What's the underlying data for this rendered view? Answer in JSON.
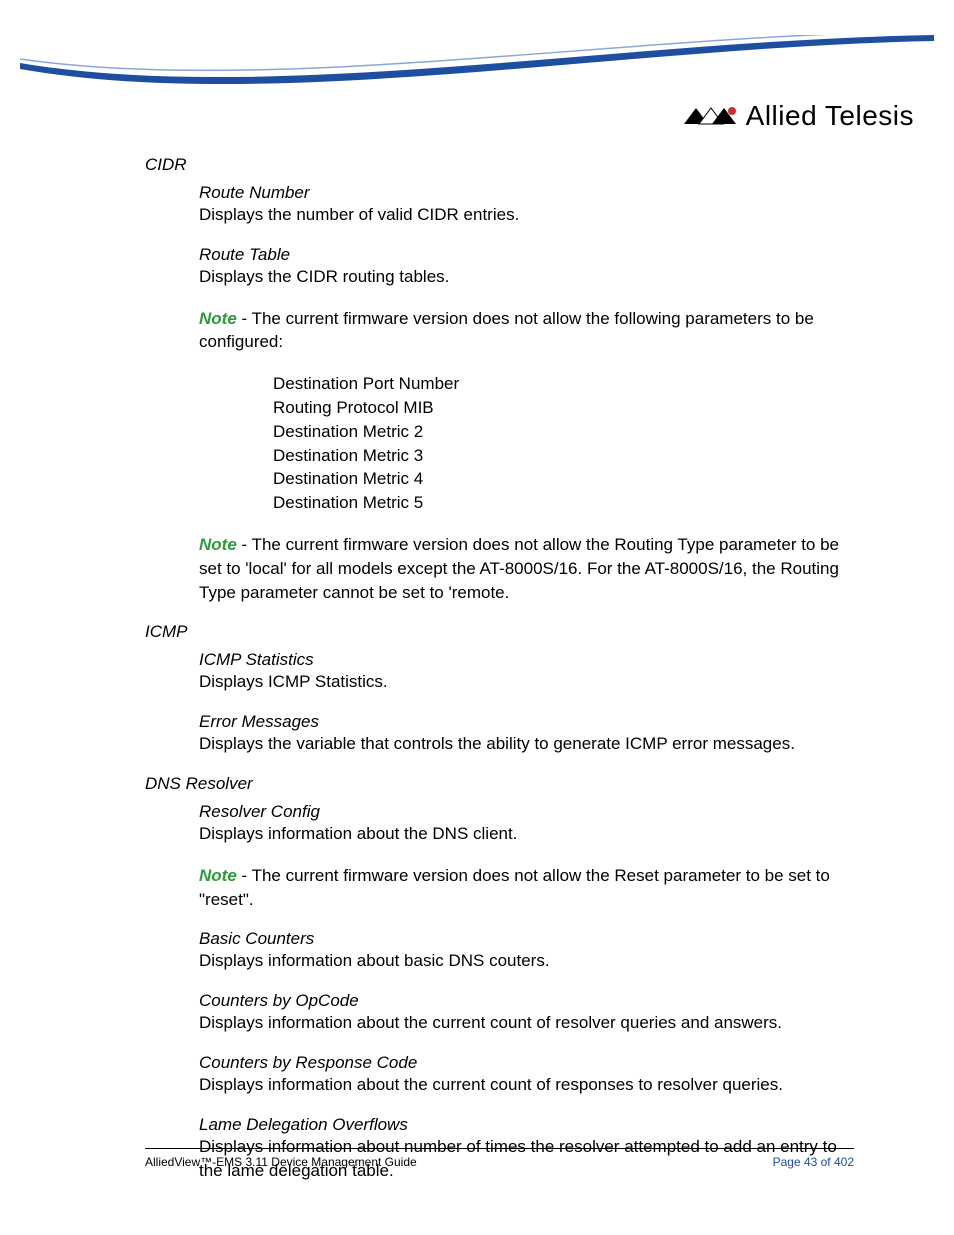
{
  "brand": {
    "name": "Allied Telesis"
  },
  "footer": {
    "left": "AlliedView™-EMS 3.11 Device Management Guide",
    "right": "Page 43 of 402"
  },
  "sections": {
    "cidr": {
      "heading": "CIDR",
      "route_number_title": "Route Number",
      "route_number_desc": "Displays the number of valid CIDR entries.",
      "route_table_title": "Route Table",
      "route_table_desc": "Displays the CIDR routing tables.",
      "note1_label": "Note",
      "note1_text": " - The current firmware version does not allow the following parameters to be configured:",
      "params": [
        "Destination Port Number",
        "Routing Protocol MIB",
        "Destination Metric 2",
        "Destination Metric 3",
        "Destination Metric 4",
        "Destination Metric 5"
      ],
      "note2_label": "Note",
      "note2_text": " - The current firmware version does not allow the Routing Type parameter to be set to 'local' for all models except the AT-8000S/16. For the AT-8000S/16, the Routing Type parameter cannot be set to 'remote."
    },
    "icmp": {
      "heading": "ICMP",
      "stats_title": "ICMP Statistics",
      "stats_desc": "Displays ICMP Statistics.",
      "err_title": "Error Messages",
      "err_desc": "Displays the variable that controls the ability to generate ICMP error messages."
    },
    "dns": {
      "heading": "DNS Resolver",
      "resolver_title": "Resolver Config",
      "resolver_desc": "Displays information about the DNS client.",
      "note_label": "Note",
      "note_text": " - The current firmware version does not allow the Reset parameter to be set to \"reset\".",
      "basic_title": "Basic Counters",
      "basic_desc": "Displays information about basic DNS couters.",
      "opcode_title": "Counters by OpCode",
      "opcode_desc": "Displays information about the current count of resolver queries and answers.",
      "respcode_title": "Counters by Response Code",
      "respcode_desc": "Displays information about the current count of responses to resolver queries.",
      "lame_title": "Lame Delegation Overflows",
      "lame_desc": "Displays information about number of times the resolver attempted to add an entry to the lame delegation table."
    }
  }
}
